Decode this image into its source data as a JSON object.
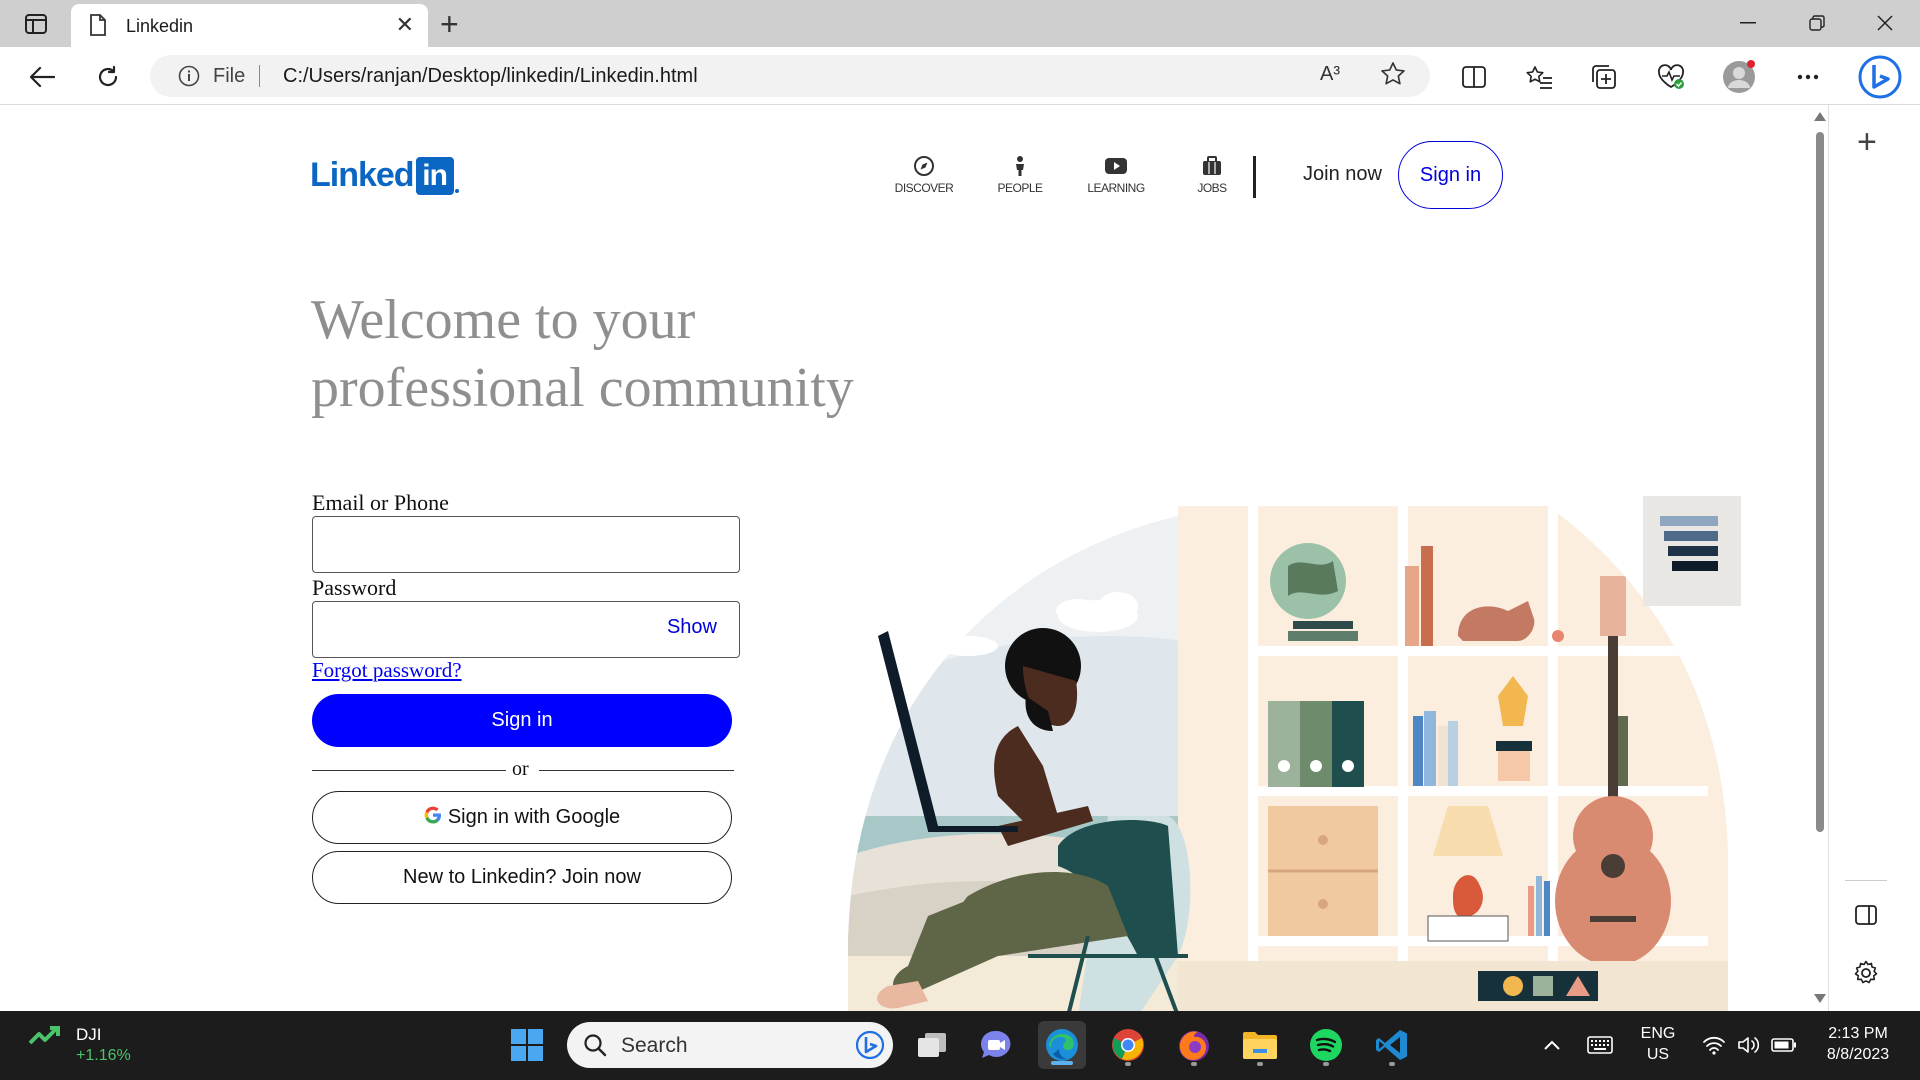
{
  "browser": {
    "tab_title": "Linkedin",
    "url_scheme_label": "File",
    "url": "C:/Users/ranjan/Desktop/linkedin/Linkedin.html",
    "read_aloud_label": "A³"
  },
  "page": {
    "logo": {
      "text": "Linked",
      "box_text": "in"
    },
    "nav": [
      {
        "label": "DISCOVER",
        "icon": "compass-icon"
      },
      {
        "label": "PEOPLE",
        "icon": "person-icon"
      },
      {
        "label": "LEARNING",
        "icon": "play-icon"
      },
      {
        "label": "JOBS",
        "icon": "briefcase-icon"
      }
    ],
    "join_now": "Join now",
    "sign_in_top": "Sign in",
    "headline_line1": "Welcome to your",
    "headline_line2": "professional community",
    "form": {
      "email_label": "Email or Phone",
      "email_value": "",
      "password_label": "Password",
      "password_value": "",
      "show_label": "Show",
      "forgot": "Forgot password?",
      "sign_in": "Sign in",
      "or": "or",
      "google": "Sign in with Google",
      "join": "New to Linkedin? Join now"
    }
  },
  "taskbar": {
    "stock_name": "DJI",
    "stock_change": "+1.16%",
    "search_label": "Search",
    "lang": "ENG",
    "region": "US",
    "time": "2:13 PM",
    "date": "8/8/2023"
  },
  "colors": {
    "linkedin_blue": "#0a66c2",
    "primary_button": "#0000ff",
    "link": "#0000ee"
  }
}
